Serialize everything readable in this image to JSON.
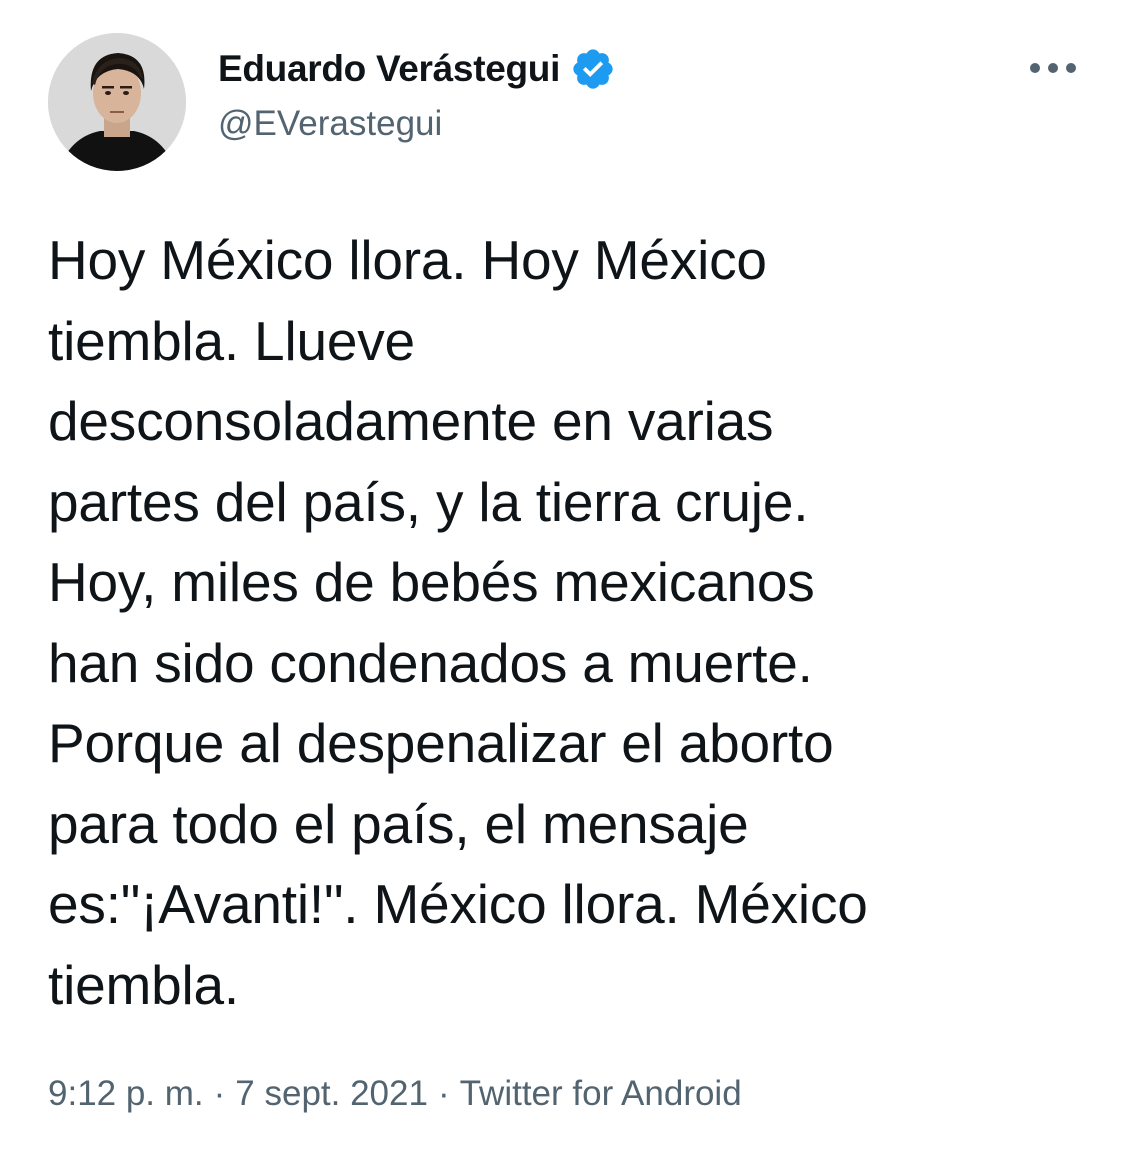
{
  "author": {
    "display_name": "Eduardo Verástegui",
    "handle": "@EVerastegui",
    "verified": true,
    "avatar_icon": "user-avatar"
  },
  "tweet": {
    "text": "Hoy México llora. Hoy México\ntiembla. Llueve\ndesconsoladamente en varias\npartes del país, y la tierra cruje.\nHoy, miles de bebés mexicanos\nhan sido condenados a muerte.\nPorque al despenalizar el aborto\npara todo el país, el mensaje\nes:\"¡Avanti!\". México llora. México\ntiembla."
  },
  "meta": {
    "time": "9:12 p. m.",
    "separator": "·",
    "date": "7 sept. 2021",
    "source": "Twitter for Android"
  },
  "colors": {
    "text": "#0f1419",
    "secondary": "#536471",
    "verified_badge": "#1d9bf0"
  },
  "icons": {
    "verified": "verified-badge-icon",
    "more": "more-options-icon"
  }
}
